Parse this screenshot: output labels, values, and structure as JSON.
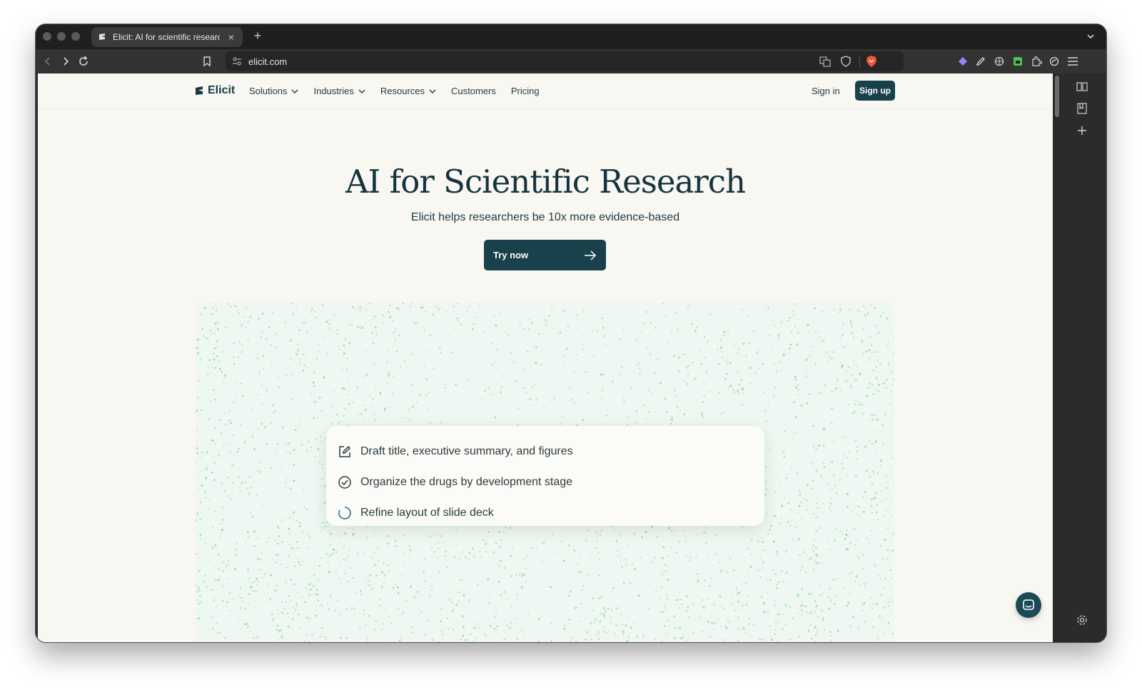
{
  "browser": {
    "tab_title": "Elicit: AI for scientific research",
    "url": "elicit.com"
  },
  "site": {
    "logo_text": "Elicit",
    "nav": [
      {
        "label": "Solutions"
      },
      {
        "label": "Industries"
      },
      {
        "label": "Resources"
      },
      {
        "label": "Customers"
      },
      {
        "label": "Pricing"
      }
    ],
    "sign_in": "Sign in",
    "sign_up": "Sign up"
  },
  "hero": {
    "title": "AI for Scientific Research",
    "subtitle": "Elicit helps researchers be 10x more evidence-based",
    "cta": "Try now"
  },
  "demo": {
    "tasks": [
      {
        "label": "Draft title, executive summary, and figures",
        "icon": "edit-icon"
      },
      {
        "label": "Organize the drugs by development stage",
        "icon": "check-circle-icon"
      },
      {
        "label": "Refine layout of slide deck",
        "icon": "loading-spinner-icon"
      }
    ]
  },
  "colors": {
    "brand": "#18414c",
    "page_bg": "#f8f7f2",
    "demo_bg": "#eef7f1",
    "dot": "#7fcfae"
  }
}
